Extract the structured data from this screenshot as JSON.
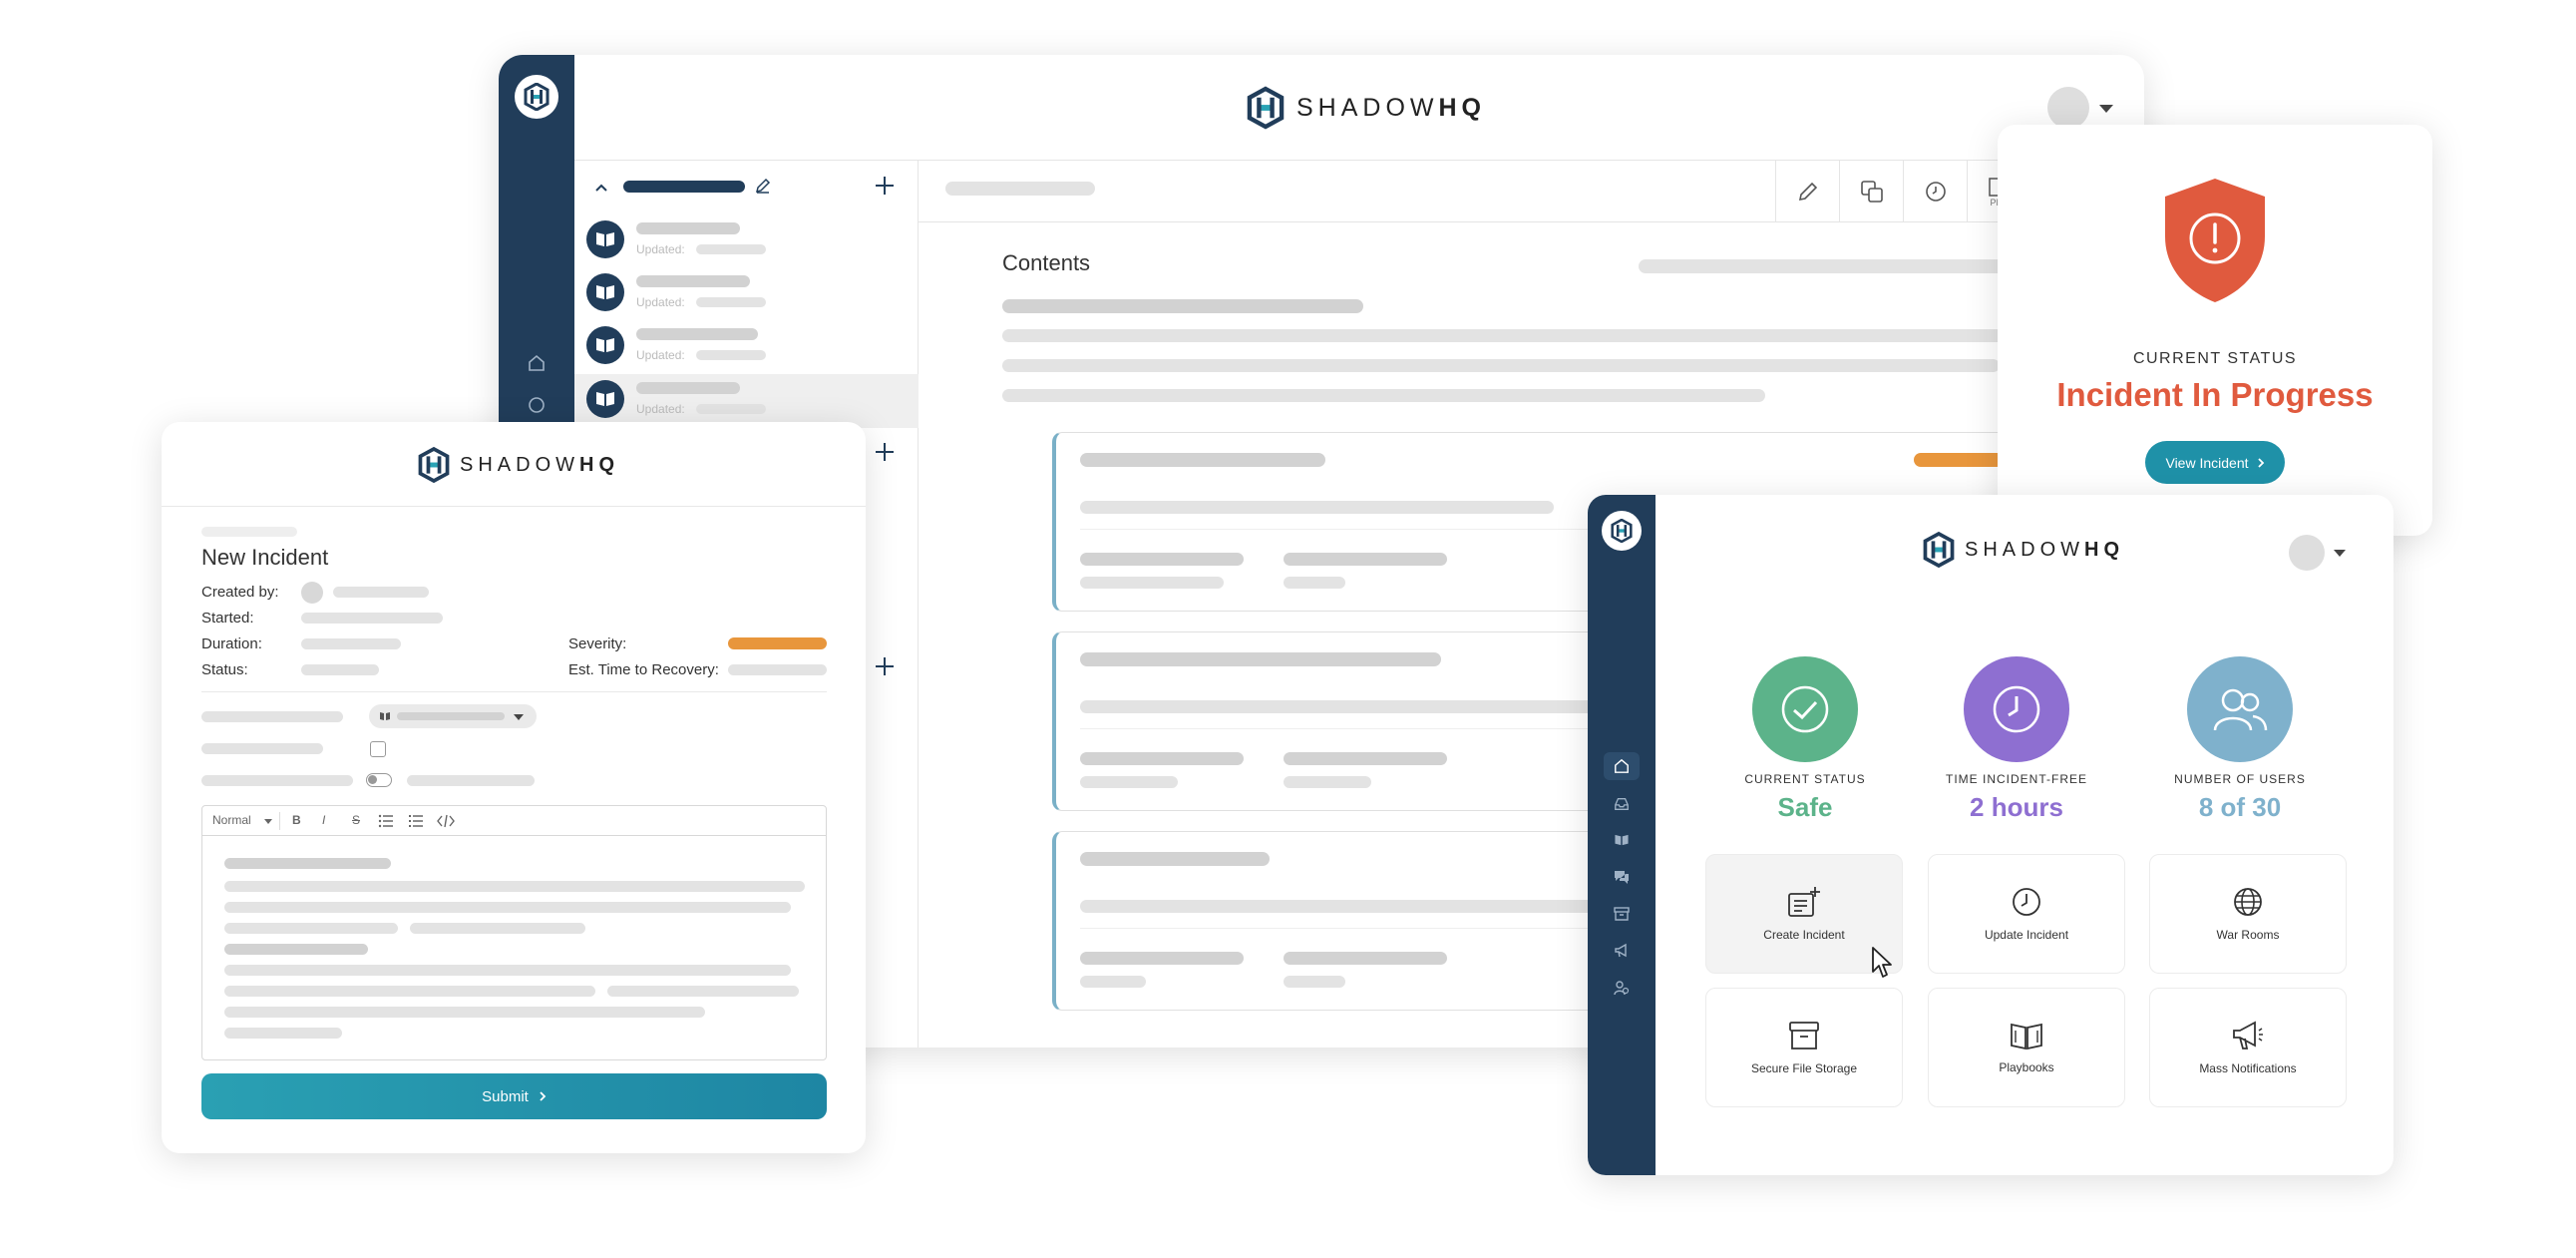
{
  "brand": {
    "name_light": "SHADOW",
    "name_bold": "HQ"
  },
  "main_window": {
    "contents_heading": "Contents",
    "updated_label": "Updated:",
    "toolbar": {
      "edit_icon": "pencil-icon",
      "copy_icon": "copy-icon",
      "history_icon": "clock-icon",
      "pdf_label": "PDF"
    }
  },
  "status_card": {
    "label": "CURRENT STATUS",
    "value": "Incident In Progress",
    "button": "View Incident",
    "color": "#e05a3e"
  },
  "incident_form": {
    "title": "New Incident",
    "created_by": "Created by:",
    "started": "Started:",
    "duration": "Duration:",
    "status": "Status:",
    "severity": "Severity:",
    "etr": "Est. Time to Recovery:",
    "editor_format": "Normal",
    "bold": "B",
    "italic": "I",
    "strike": "S",
    "submit": "Submit",
    "severity_color": "#e8963c"
  },
  "dashboard": {
    "stats": [
      {
        "label": "CURRENT STATUS",
        "value": "Safe",
        "color": "#5cb38a"
      },
      {
        "label": "TIME INCIDENT-FREE",
        "value": "2 hours",
        "color": "#8e6fd1"
      },
      {
        "label": "NUMBER OF USERS",
        "value": "8 of 30",
        "color": "#7fb1cc"
      }
    ],
    "tiles": [
      {
        "label": "Create Incident",
        "icon": "create-incident-icon"
      },
      {
        "label": "Update Incident",
        "icon": "clock-icon"
      },
      {
        "label": "War Rooms",
        "icon": "globe-icon"
      },
      {
        "label": "Secure File Storage",
        "icon": "archive-box-icon"
      },
      {
        "label": "Playbooks",
        "icon": "book-icon"
      },
      {
        "label": "Mass Notifications",
        "icon": "megaphone-icon"
      }
    ]
  }
}
